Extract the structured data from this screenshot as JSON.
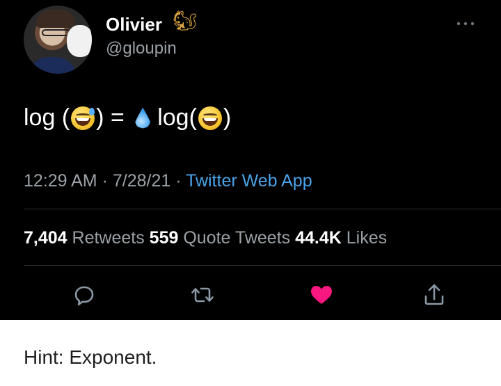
{
  "tweet": {
    "author": {
      "display_name": "Olivier",
      "name_emoji": "🐿",
      "handle": "@gloupin"
    },
    "more_icon": "more-horizontal-icon",
    "text": {
      "part1": "log (",
      "emoji1": "grinning-face-with-sweat",
      "part2": ") = ",
      "emoji2": "droplet",
      "part3": "log(",
      "emoji3": "grinning-face-with-smiling-eyes",
      "part4": ")"
    },
    "meta": {
      "time": "12:29 AM",
      "separator1": " · ",
      "date": "7/28/21",
      "separator2": " · ",
      "source": "Twitter Web App"
    },
    "stats": {
      "retweets_count": "7,404",
      "retweets_label": " Retweets ",
      "quotes_count": "559",
      "quotes_label": " Quote Tweets ",
      "likes_count": "44.4K",
      "likes_label": " Likes"
    },
    "actions": {
      "reply_icon": "reply-icon",
      "retweet_icon": "retweet-icon",
      "like_icon": "heart-icon",
      "share_icon": "share-icon",
      "like_color": "#f91880"
    }
  },
  "caption": "Hint: Exponent."
}
